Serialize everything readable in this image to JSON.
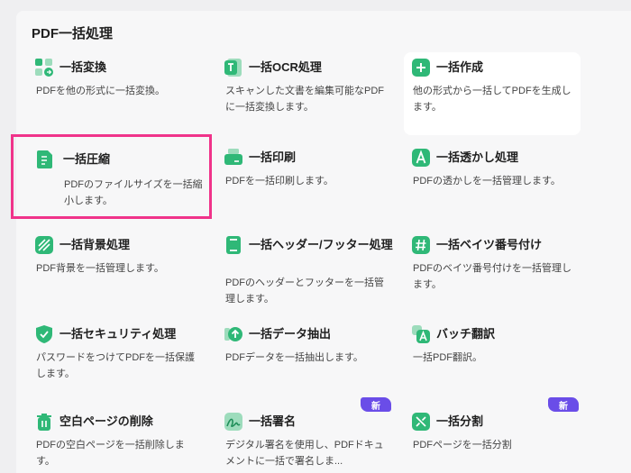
{
  "panel": {
    "title": "PDF一括処理"
  },
  "colors": {
    "icon_green": "#2fb877",
    "selection": "#f0338a",
    "badge": "#6a4de8"
  },
  "cards": [
    {
      "name": "batch-convert",
      "icon": "grid-convert-icon",
      "title": "一括変換",
      "desc": "PDFを他の形式に一括変換。"
    },
    {
      "name": "batch-ocr",
      "icon": "text-ocr-icon",
      "title": "一括OCR処理",
      "desc": "スキャンした文書を編集可能なPDFに一括変換します。"
    },
    {
      "name": "batch-create",
      "icon": "plus-icon",
      "title": "一括作成",
      "desc": "他の形式から一括してPDFを生成します。"
    },
    {
      "name": "batch-compress",
      "icon": "compress-icon",
      "title": "一括圧縮",
      "desc": "PDFのファイルサイズを一括縮小します。"
    },
    {
      "name": "batch-print",
      "icon": "printer-icon",
      "title": "一括印刷",
      "desc": "PDFを一括印刷します。"
    },
    {
      "name": "batch-watermark",
      "icon": "watermark-icon",
      "title": "一括透かし処理",
      "desc": "PDFの透かしを一括管理します。"
    },
    {
      "name": "batch-background",
      "icon": "background-icon",
      "title": "一括背景処理",
      "desc": "PDF背景を一括管理します。"
    },
    {
      "name": "batch-header-footer",
      "icon": "header-footer-icon",
      "title": "一括ヘッダー/フッター処理",
      "desc": "PDFのヘッダーとフッターを一括管理します。"
    },
    {
      "name": "batch-bates",
      "icon": "hash-icon",
      "title": "一括ベイツ番号付け",
      "desc": "PDFのベイツ番号付けを一括管理します。"
    },
    {
      "name": "batch-security",
      "icon": "shield-check-icon",
      "title": "一括セキュリティ処理",
      "desc": "パスワードをつけてPDFを一括保護します。"
    },
    {
      "name": "batch-data-extract",
      "icon": "extract-arrow-icon",
      "title": "一括データ抽出",
      "desc": "PDFデータを一括抽出します。"
    },
    {
      "name": "batch-translate",
      "icon": "translate-icon",
      "title": "バッチ翻訳",
      "desc": "一括PDF翻訳。"
    },
    {
      "name": "delete-blank-pages",
      "icon": "trash-icon",
      "title": "空白ページの削除",
      "desc": "PDFの空白ページを一括削除します。"
    },
    {
      "name": "batch-sign",
      "icon": "signature-icon",
      "title": "一括署名",
      "desc": "デジタル署名を使用し、PDFドキュメントに一括で署名しま...",
      "badge": "新"
    },
    {
      "name": "batch-split",
      "icon": "split-icon",
      "title": "一括分割",
      "desc": "PDFページを一括分割",
      "badge": "新"
    }
  ]
}
